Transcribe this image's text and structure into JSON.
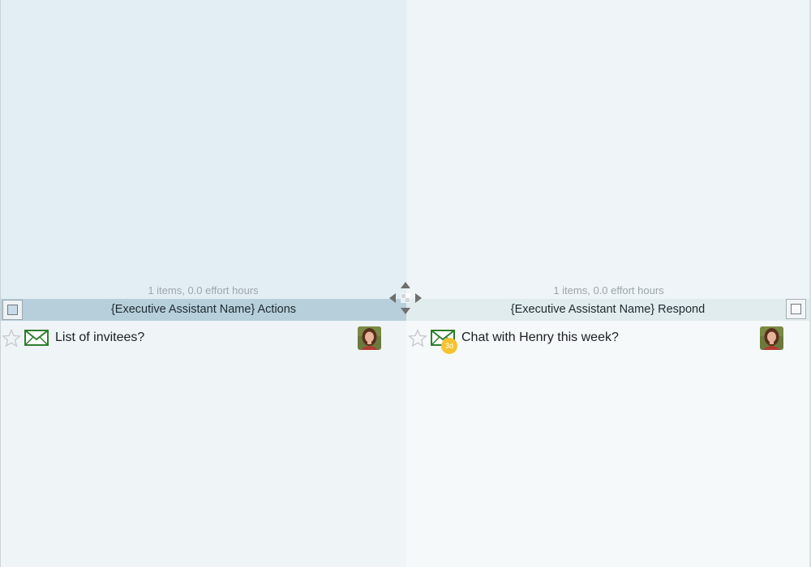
{
  "colors": {
    "accent_left": "#b7cfdb",
    "accent_right": "#e0eced",
    "mail_green": "#2e7d2e",
    "badge_yellow": "#f5c330"
  },
  "quadrants": {
    "left": {
      "stats": "1 items, 0.0 effort hours",
      "title": "{Executive Assistant Name} Actions",
      "tasks": [
        {
          "label": "List of invitees?",
          "icon": "mail-icon",
          "starred": false
        }
      ]
    },
    "right": {
      "stats": "1 items, 0.0 effort hours",
      "title": "{Executive Assistant Name} Respond",
      "tasks": [
        {
          "label": "Chat with Henry this week?",
          "icon": "mail-icon",
          "starred": false,
          "age_badge": "3d"
        }
      ]
    }
  }
}
